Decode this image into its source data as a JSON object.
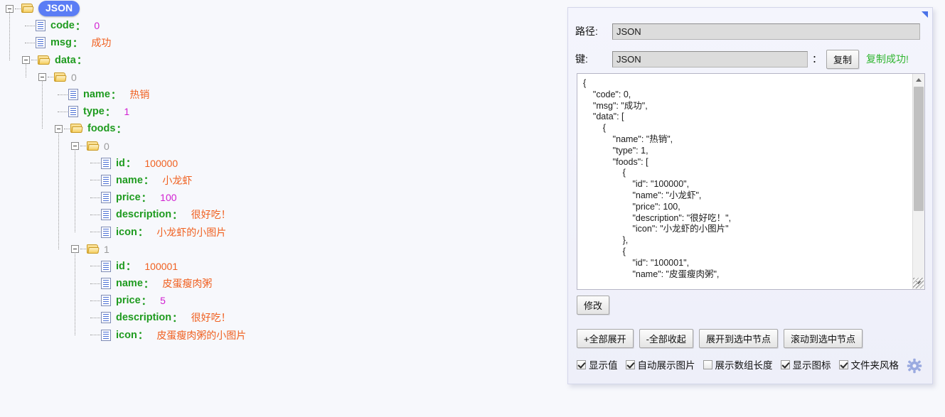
{
  "tree": {
    "root_label": "JSON",
    "root_selected": true,
    "nodes": [
      {
        "depth": 0,
        "kind": "folder",
        "expanded": true,
        "key": "JSON",
        "badge": true,
        "colon": false,
        "value": "",
        "value_type": ""
      },
      {
        "depth": 1,
        "kind": "doc",
        "key": "code",
        "colon": true,
        "value": "0",
        "value_type": "number"
      },
      {
        "depth": 1,
        "kind": "doc",
        "key": "msg",
        "colon": true,
        "value": "成功",
        "value_type": "string"
      },
      {
        "depth": 1,
        "kind": "folder",
        "expanded": true,
        "key": "data",
        "colon": true,
        "value": "",
        "value_type": ""
      },
      {
        "depth": 2,
        "kind": "folder",
        "expanded": true,
        "key": "0",
        "colon": false,
        "index": true,
        "value": "",
        "value_type": ""
      },
      {
        "depth": 3,
        "kind": "doc",
        "key": "name",
        "colon": true,
        "value": "热销",
        "value_type": "string"
      },
      {
        "depth": 3,
        "kind": "doc",
        "key": "type",
        "colon": true,
        "value": "1",
        "value_type": "number"
      },
      {
        "depth": 3,
        "kind": "folder",
        "expanded": true,
        "key": "foods",
        "colon": true,
        "value": "",
        "value_type": ""
      },
      {
        "depth": 4,
        "kind": "folder",
        "expanded": true,
        "key": "0",
        "colon": false,
        "index": true,
        "value": "",
        "value_type": ""
      },
      {
        "depth": 5,
        "kind": "doc",
        "key": "id",
        "colon": true,
        "value": "100000",
        "value_type": "string"
      },
      {
        "depth": 5,
        "kind": "doc",
        "key": "name",
        "colon": true,
        "value": "小龙虾",
        "value_type": "string"
      },
      {
        "depth": 5,
        "kind": "doc",
        "key": "price",
        "colon": true,
        "value": "100",
        "value_type": "number"
      },
      {
        "depth": 5,
        "kind": "doc",
        "key": "description",
        "colon": true,
        "value": "很好吃！",
        "value_type": "string"
      },
      {
        "depth": 5,
        "kind": "doc",
        "key": "icon",
        "colon": true,
        "value": "小龙虾的小图片",
        "value_type": "string"
      },
      {
        "depth": 4,
        "kind": "folder",
        "expanded": true,
        "key": "1",
        "colon": false,
        "index": true,
        "value": "",
        "value_type": ""
      },
      {
        "depth": 5,
        "kind": "doc",
        "key": "id",
        "colon": true,
        "value": "100001",
        "value_type": "string"
      },
      {
        "depth": 5,
        "kind": "doc",
        "key": "name",
        "colon": true,
        "value": "皮蛋瘦肉粥",
        "value_type": "string"
      },
      {
        "depth": 5,
        "kind": "doc",
        "key": "price",
        "colon": true,
        "value": "5",
        "value_type": "number"
      },
      {
        "depth": 5,
        "kind": "doc",
        "key": "description",
        "colon": true,
        "value": "很好吃！",
        "value_type": "string"
      },
      {
        "depth": 5,
        "kind": "doc",
        "key": "icon",
        "colon": true,
        "value": "皮蛋瘦肉粥的小图片",
        "value_type": "string"
      }
    ]
  },
  "panel": {
    "collapse_icon": "collapse-triangle-icon",
    "path_label": "路径:",
    "path_value": "JSON",
    "key_label": "键:",
    "key_value": "JSON",
    "key_colon": "：",
    "copy_button": "复制",
    "copy_status": "复制成功!",
    "json_text": "{\n    \"code\": 0,\n    \"msg\": \"成功\",\n    \"data\": [\n        {\n            \"name\": \"热销\",\n            \"type\": 1,\n            \"foods\": [\n                {\n                    \"id\": \"100000\",\n                    \"name\": \"小龙虾\",\n                    \"price\": 100,\n                    \"description\": \"很好吃！\",\n                    \"icon\": \"小龙虾的小图片\"\n                },\n                {\n                    \"id\": \"100001\",\n                    \"name\": \"皮蛋瘦肉粥\",",
    "edit_button": "修改",
    "action_buttons": [
      "+全部展开",
      "-全部收起",
      "展开到选中节点",
      "滚动到选中节点"
    ],
    "checkboxes": [
      {
        "label": "显示值",
        "checked": true
      },
      {
        "label": "自动展示图片",
        "checked": true
      },
      {
        "label": "展示数组长度",
        "checked": false
      },
      {
        "label": "显示图标",
        "checked": true
      },
      {
        "label": "文件夹风格",
        "checked": true
      }
    ],
    "gear_icon": "gear-icon"
  },
  "colors": {
    "key_green": "#1f9b1f",
    "string_orange": "#f06020",
    "number_magenta": "#d11fd1",
    "selection_blue": "#5b7df5",
    "success_green": "#2fb52f",
    "page_bg": "#f7f8fc",
    "panel_bg": "#f1f2fb"
  }
}
